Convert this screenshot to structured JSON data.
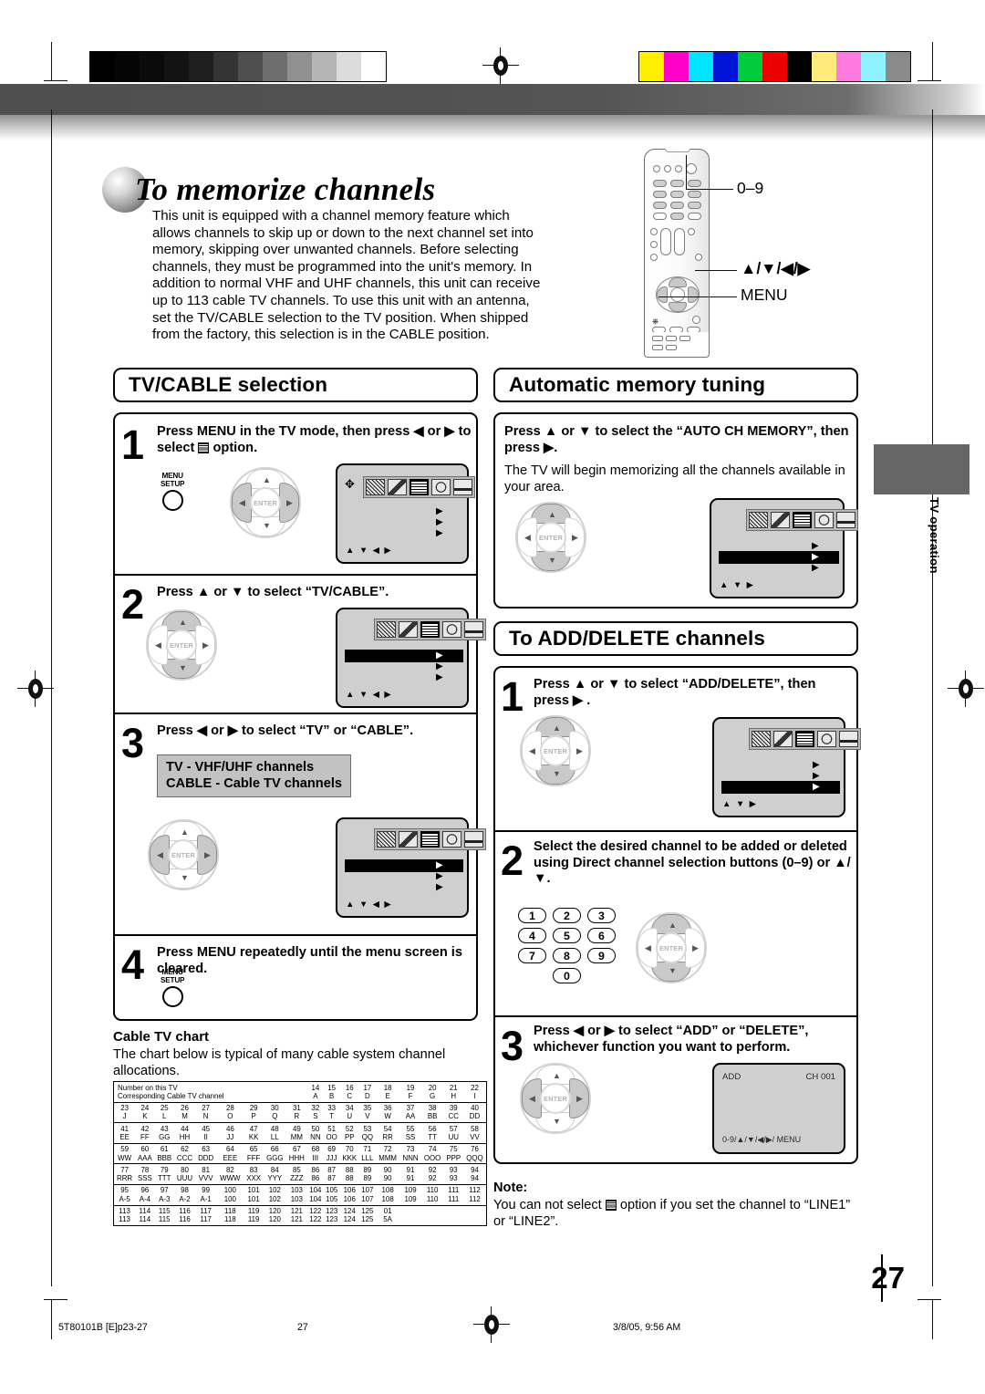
{
  "page": {
    "title": "To memorize channels",
    "intro": "This unit is equipped with a channel memory feature which allows channels to skip up or down to the next channel set into memory, skipping over unwanted channels. Before selecting channels, they must be programmed into the unit's memory. In addition to normal VHF and UHF channels, this unit can receive up to 113 cable TV channels. To use this unit with an antenna, set the TV/CABLE selection to the TV position. When shipped from the factory, this selection is in the CABLE position.",
    "page_number": "27",
    "side_tab": "TV operation"
  },
  "footer": {
    "left": "5T80101B [E]p23-27",
    "center": "27",
    "right": "3/8/05, 9:56 AM"
  },
  "remote": {
    "labels": {
      "numeric": "0–9",
      "arrows": "▲/▼/◀/▶",
      "menu": "MENU"
    }
  },
  "osd_common": {
    "icon_names": [
      "clock-timer-icon",
      "picture-av-icon",
      "channel-grid-icon",
      "prohibited-lock-icon",
      "closed-caption-icon"
    ],
    "selected_icon_index": 2,
    "hint_4way": "▲ ▼ ◀ ▶",
    "hint_3way": "▲ ▼ ▶"
  },
  "tv_cable": {
    "heading": "TV/CABLE selection",
    "steps": [
      {
        "num": "1",
        "text_before": "Press MENU in the TV mode, then press ◀ or ▶ to select ",
        "text_after": " option.",
        "button_label_line1": "MENU",
        "button_label_line2": "SETUP"
      },
      {
        "num": "2",
        "text": "Press ▲ or ▼ to select “TV/CABLE”."
      },
      {
        "num": "3",
        "text": "Press ◀ or ▶ to select “TV” or “CABLE”.",
        "callout_line1": "TV - VHF/UHF channels",
        "callout_line2": "CABLE - Cable TV channels"
      },
      {
        "num": "4",
        "text": "Press MENU repeatedly until the menu screen is cleared.",
        "button_label_line1": "MENU",
        "button_label_line2": "SETUP"
      }
    ]
  },
  "auto_memory": {
    "heading": "Automatic memory tuning",
    "step_text": "Press ▲ or ▼ to select the “AUTO CH MEMORY”, then press ▶.",
    "body_text": "The TV will begin memorizing all the channels available in your area."
  },
  "add_delete": {
    "heading": "To ADD/DELETE channels",
    "steps": [
      {
        "num": "1",
        "text": "Press ▲ or ▼ to select “ADD/DELETE”, then press ▶ ."
      },
      {
        "num": "2",
        "text": "Select the desired channel to be added or deleted using Direct channel selection buttons (0–9) or ▲/▼."
      },
      {
        "num": "3",
        "text": "Press ◀ or ▶ to select “ADD” or “DELETE”, whichever function you want to perform."
      }
    ],
    "keypad": [
      [
        "1",
        "2",
        "3"
      ],
      [
        "4",
        "5",
        "6"
      ],
      [
        "7",
        "8",
        "9"
      ],
      [
        "0"
      ]
    ],
    "add_screen": {
      "mode": "ADD",
      "channel": "CH 001",
      "hint": "0-9/▲/▼/◀/▶/ MENU"
    },
    "note_label": "Note:",
    "note_before": "You can not select ",
    "note_after": " option if you set the channel to “LINE1” or “LINE2”."
  },
  "cable_chart": {
    "heading": "Cable TV chart",
    "intro": "The chart below is typical of many cable system channel allocations.",
    "row_label_1": "Number on this TV",
    "row_label_2": "Corresponding Cable TV channel",
    "rows": [
      {
        "tv": [
          "14",
          "15",
          "16",
          "17",
          "18",
          "19",
          "20",
          "21",
          "22"
        ],
        "cable": [
          "A",
          "B",
          "C",
          "D",
          "E",
          "F",
          "G",
          "H",
          "I"
        ],
        "offset": 9
      },
      {
        "tv": [
          "23",
          "24",
          "25",
          "26",
          "27",
          "28",
          "29",
          "30",
          "31",
          "32",
          "33",
          "34",
          "35",
          "36",
          "37",
          "38",
          "39",
          "40"
        ],
        "cable": [
          "J",
          "K",
          "L",
          "M",
          "N",
          "O",
          "P",
          "Q",
          "R",
          "S",
          "T",
          "U",
          "V",
          "W",
          "AA",
          "BB",
          "CC",
          "DD"
        ],
        "offset": 0
      },
      {
        "tv": [
          "41",
          "42",
          "43",
          "44",
          "45",
          "46",
          "47",
          "48",
          "49",
          "50",
          "51",
          "52",
          "53",
          "54",
          "55",
          "56",
          "57",
          "58"
        ],
        "cable": [
          "EE",
          "FF",
          "GG",
          "HH",
          "II",
          "JJ",
          "KK",
          "LL",
          "MM",
          "NN",
          "OO",
          "PP",
          "QQ",
          "RR",
          "SS",
          "TT",
          "UU",
          "VV"
        ],
        "offset": 0
      },
      {
        "tv": [
          "59",
          "60",
          "61",
          "62",
          "63",
          "64",
          "65",
          "66",
          "67",
          "68",
          "69",
          "70",
          "71",
          "72",
          "73",
          "74",
          "75",
          "76"
        ],
        "cable": [
          "WW",
          "AAA",
          "BBB",
          "CCC",
          "DDD",
          "EEE",
          "FFF",
          "GGG",
          "HHH",
          "III",
          "JJJ",
          "KKK",
          "LLL",
          "MMM",
          "NNN",
          "OOO",
          "PPP",
          "QQQ"
        ],
        "offset": 0
      },
      {
        "tv": [
          "77",
          "78",
          "79",
          "80",
          "81",
          "82",
          "83",
          "84",
          "85",
          "86",
          "87",
          "88",
          "89",
          "90",
          "91",
          "92",
          "93",
          "94"
        ],
        "cable": [
          "RRR",
          "SSS",
          "TTT",
          "UUU",
          "VVV",
          "WWW",
          "XXX",
          "YYY",
          "ZZZ",
          "86",
          "87",
          "88",
          "89",
          "90",
          "91",
          "92",
          "93",
          "94"
        ],
        "offset": 0
      },
      {
        "tv": [
          "95",
          "96",
          "97",
          "98",
          "99",
          "100",
          "101",
          "102",
          "103",
          "104",
          "105",
          "106",
          "107",
          "108",
          "109",
          "110",
          "111",
          "112"
        ],
        "cable": [
          "A-5",
          "A-4",
          "A-3",
          "A-2",
          "A-1",
          "100",
          "101",
          "102",
          "103",
          "104",
          "105",
          "106",
          "107",
          "108",
          "109",
          "110",
          "111",
          "112"
        ],
        "offset": 0
      },
      {
        "tv": [
          "113",
          "114",
          "115",
          "116",
          "117",
          "118",
          "119",
          "120",
          "121",
          "122",
          "123",
          "124",
          "125",
          "01"
        ],
        "cable": [
          "113",
          "114",
          "115",
          "116",
          "117",
          "118",
          "119",
          "120",
          "121",
          "122",
          "123",
          "124",
          "125",
          "5A"
        ],
        "offset": 0
      }
    ]
  },
  "calibration": {
    "grayscale": [
      "#000000",
      "#050505",
      "#0b0b0b",
      "#131313",
      "#1f1f1f",
      "#343434",
      "#4f4f4f",
      "#6e6e6e",
      "#909090",
      "#b5b5b5",
      "#dcdcdc",
      "#ffffff"
    ],
    "colors": [
      "#ffee00",
      "#ff00c8",
      "#00e5ff",
      "#0015d8",
      "#00cc3c",
      "#ee0000",
      "#000000",
      "#ffeb7a",
      "#ff7ae0",
      "#8ef2ff",
      "#8a8a8a"
    ]
  }
}
